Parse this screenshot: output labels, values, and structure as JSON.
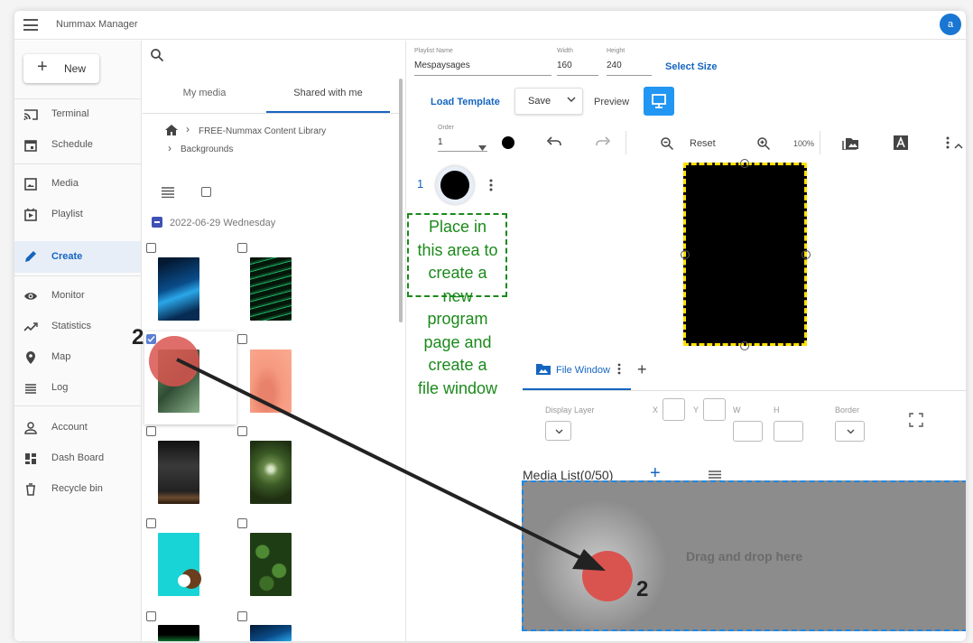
{
  "app": {
    "title": "Nummax Manager",
    "avatar_letter": "a"
  },
  "sidebar": {
    "new_label": "New",
    "items": [
      {
        "label": "Terminal",
        "icon": "cast-icon"
      },
      {
        "label": "Schedule",
        "icon": "calendar-icon"
      },
      {
        "label": "Media",
        "icon": "image-icon"
      },
      {
        "label": "Playlist",
        "icon": "playlist-icon"
      },
      {
        "label": "Create",
        "icon": "pencil-icon",
        "active": true
      },
      {
        "label": "Monitor",
        "icon": "eye-icon"
      },
      {
        "label": "Statistics",
        "icon": "trend-icon"
      },
      {
        "label": "Map",
        "icon": "map-pin-icon"
      },
      {
        "label": "Log",
        "icon": "list-icon"
      },
      {
        "label": "Account",
        "icon": "person-icon"
      },
      {
        "label": "Dash Board",
        "icon": "dashboard-icon"
      },
      {
        "label": "Recycle bin",
        "icon": "trash-icon"
      }
    ]
  },
  "media_panel": {
    "tabs": [
      "My media",
      "Shared with me"
    ],
    "active_tab": "Shared with me",
    "breadcrumb": [
      "FREE-Nummax Content Library",
      "Backgrounds"
    ],
    "date_group": "2022-06-29 Wednesday",
    "thumb_colors": {
      "blue_wave": "#0a4c8a",
      "green_lines": "#0b3d1f",
      "green_leaf": "#4f7a53",
      "salmon_feather": "#f69a80",
      "dark_smoke": "#3a3a3a",
      "forest_canopy": "#4b6b35",
      "cyan_coconut": "#19d4d6",
      "green_tree": "#2d5a1f"
    }
  },
  "editor": {
    "playlist_name_label": "Playlist Name",
    "playlist_name": "Mespaysages",
    "width_label": "Width",
    "width": "160",
    "height_label": "Height",
    "height": "240",
    "select_size": "Select Size",
    "load_template": "Load Template",
    "save": "Save",
    "preview": "Preview",
    "order_label": "Order",
    "order_value": "1",
    "reset": "Reset",
    "zoom": "100%",
    "page_number": "1",
    "instruction": [
      "Place in",
      "this area to",
      "create a",
      "new",
      "program",
      "page and",
      "create a",
      "file window"
    ],
    "file_window_tab": "File Window",
    "display_layer": "Display Layer",
    "x_label": "X",
    "y_label": "Y",
    "w_label": "W",
    "h_label": "H",
    "border_label": "Border",
    "media_list": "Media List(0/50)",
    "drop_text": "Drag and drop here",
    "step_number": "2"
  },
  "colors": {
    "accent": "#1565c0",
    "instruction_green": "#1b8a1b",
    "marker_red": "#d9534f",
    "screen_border": "#ffe000"
  }
}
